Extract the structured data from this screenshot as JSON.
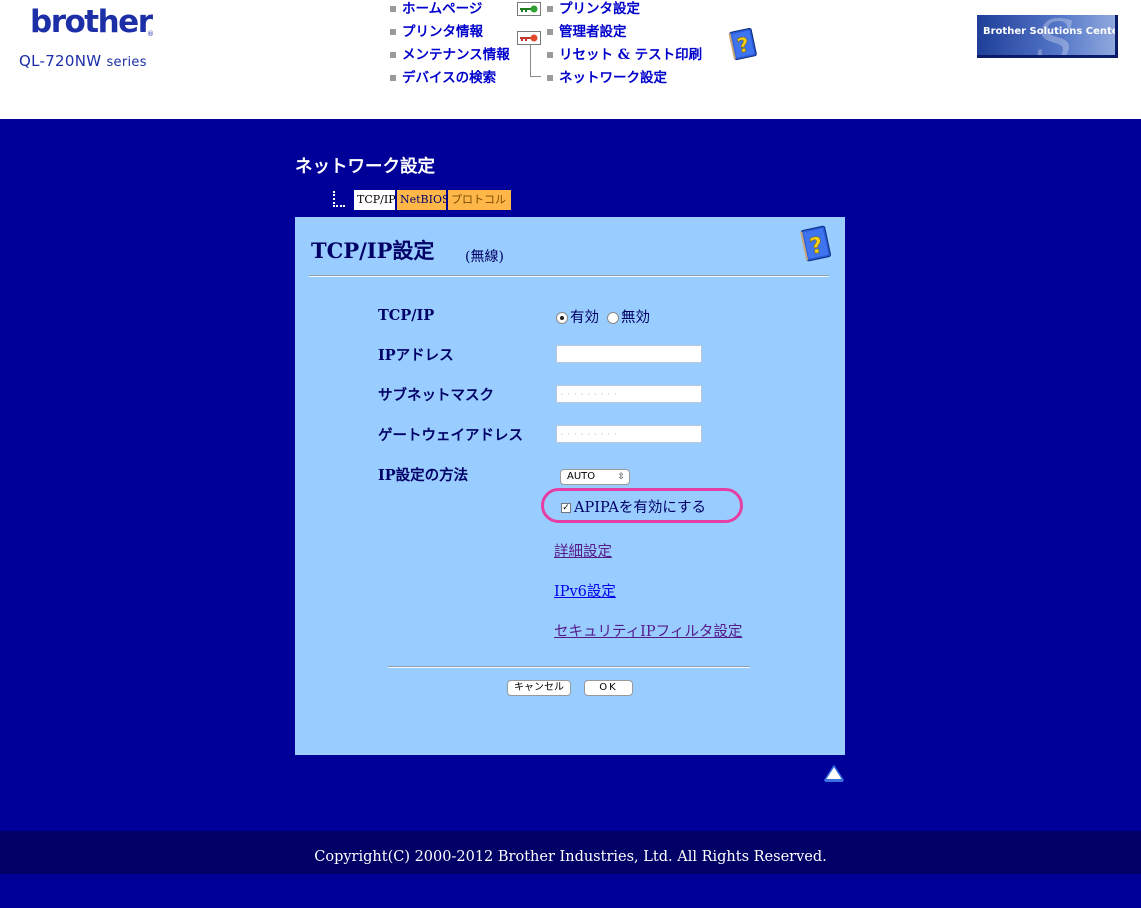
{
  "brand": {
    "logo_text": "brother",
    "registered_mark": "®",
    "model": "QL-720NW",
    "series": "series"
  },
  "nav": {
    "left": [
      "ホームページ",
      "プリンタ情報",
      "メンテナンス情報",
      "デバイスの検索"
    ],
    "right": [
      "プリンタ設定",
      "管理者設定",
      "リセット & テスト印刷",
      "ネットワーク設定"
    ]
  },
  "solutions_center": {
    "label": "Brother Solutions Center"
  },
  "page": {
    "title": "ネットワーク設定"
  },
  "tabs": [
    "TCP/IP",
    "NetBIOS",
    "プロトコル"
  ],
  "panel": {
    "title": "TCP/IP設定",
    "subtitle": "(無線)",
    "fields": {
      "tcpip": {
        "label": "TCP/IP",
        "enabled_label": "有効",
        "disabled_label": "無効",
        "selected": "有効"
      },
      "ip_address": {
        "label": "IPアドレス",
        "value": "",
        "placeholder": ""
      },
      "subnet_mask": {
        "label": "サブネットマスク",
        "value": "",
        "placeholder": "· · · · · · · · ·"
      },
      "gateway": {
        "label": "ゲートウェイアドレス",
        "value": "",
        "placeholder": "· · · · · · · · ·"
      },
      "ip_method": {
        "label": "IP設定の方法",
        "selected": "AUTO"
      },
      "apipa": {
        "label": "APIPAを有効にする",
        "checked": true,
        "check_mark": "✓"
      }
    },
    "links": {
      "advanced": "詳細設定",
      "ipv6": "IPv6設定",
      "security_filter": "セキュリティIPフィルタ設定"
    },
    "buttons": {
      "cancel": "キャンセル",
      "ok": "OK"
    }
  },
  "footer": {
    "copyright": "Copyright(C) 2000-2012 Brother Industries, Ltd. All Rights Reserved."
  },
  "colors": {
    "main_bg": "#000099",
    "panel_bg": "#99ccff",
    "footer_bg": "#000066",
    "tab_inactive": "#ffb74a",
    "nav_link": "#0000cc",
    "highlight": "#e53fa3"
  },
  "icons": [
    "key-green-icon",
    "key-red-icon",
    "help-book-icon",
    "back-to-top-icon"
  ]
}
